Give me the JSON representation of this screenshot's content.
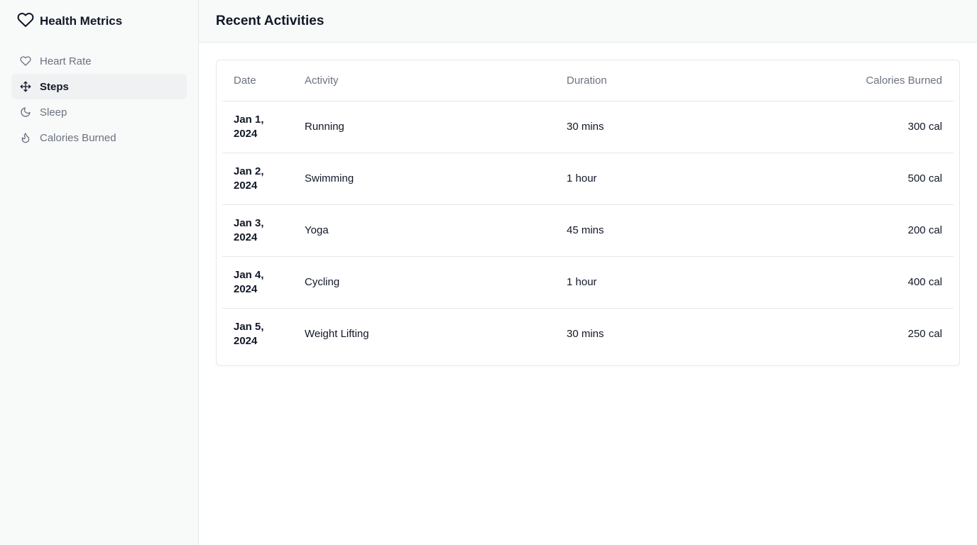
{
  "app": {
    "title": "Health Metrics"
  },
  "sidebar": {
    "items": [
      {
        "label": "Heart Rate",
        "icon": "heart-icon",
        "active": false
      },
      {
        "label": "Steps",
        "icon": "move-icon",
        "active": true
      },
      {
        "label": "Sleep",
        "icon": "moon-icon",
        "active": false
      },
      {
        "label": "Calories Burned",
        "icon": "flame-icon",
        "active": false
      }
    ]
  },
  "header": {
    "title": "Recent Activities"
  },
  "table": {
    "columns": [
      "Date",
      "Activity",
      "Duration",
      "Calories Burned"
    ],
    "rows": [
      {
        "date": "Jan 1, 2024",
        "activity": "Running",
        "duration": "30 mins",
        "calories": "300 cal"
      },
      {
        "date": "Jan 2, 2024",
        "activity": "Swimming",
        "duration": "1 hour",
        "calories": "500 cal"
      },
      {
        "date": "Jan 3, 2024",
        "activity": "Yoga",
        "duration": "45 mins",
        "calories": "200 cal"
      },
      {
        "date": "Jan 4, 2024",
        "activity": "Cycling",
        "duration": "1 hour",
        "calories": "400 cal"
      },
      {
        "date": "Jan 5, 2024",
        "activity": "Weight Lifting",
        "duration": "30 mins",
        "calories": "250 cal"
      }
    ]
  },
  "colors": {
    "text": "#111827",
    "muted": "#6b7280",
    "border": "#e5e7eb",
    "sidebar_bg": "#f8f9f9",
    "active_bg": "#f0f1f3"
  }
}
